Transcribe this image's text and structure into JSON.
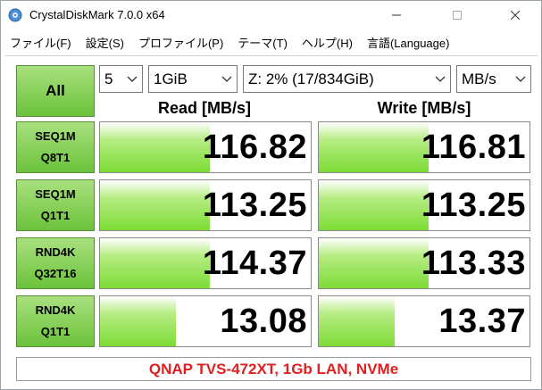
{
  "window": {
    "title": "CrystalDiskMark 7.0.0 x64"
  },
  "menu": {
    "items": [
      "ファイル(F)",
      "設定(S)",
      "プロファイル(P)",
      "テーマ(T)",
      "ヘルプ(H)",
      "言語(Language)"
    ]
  },
  "controls": {
    "all_label": "All",
    "count": "5",
    "size": "1GiB",
    "drive": "Z: 2% (17/834GiB)",
    "unit": "MB/s"
  },
  "headers": {
    "read": "Read [MB/s]",
    "write": "Write [MB/s]"
  },
  "tests": [
    {
      "line1": "SEQ1M",
      "line2": "Q8T1",
      "read": "116.82",
      "write": "116.81",
      "read_fill": 0.52,
      "write_fill": 0.52
    },
    {
      "line1": "SEQ1M",
      "line2": "Q1T1",
      "read": "113.25",
      "write": "113.25",
      "read_fill": 0.52,
      "write_fill": 0.52
    },
    {
      "line1": "RND4K",
      "line2": "Q32T16",
      "read": "114.37",
      "write": "113.33",
      "read_fill": 0.52,
      "write_fill": 0.52
    },
    {
      "line1": "RND4K",
      "line2": "Q1T1",
      "read": "13.08",
      "write": "13.37",
      "read_fill": 0.36,
      "write_fill": 0.36
    }
  ],
  "comment": {
    "text": "QNAP TVS-472XT, 1Gb LAN, NVMe",
    "color": "#e02020"
  },
  "colors": {
    "accent_green": "#7ddc35"
  }
}
